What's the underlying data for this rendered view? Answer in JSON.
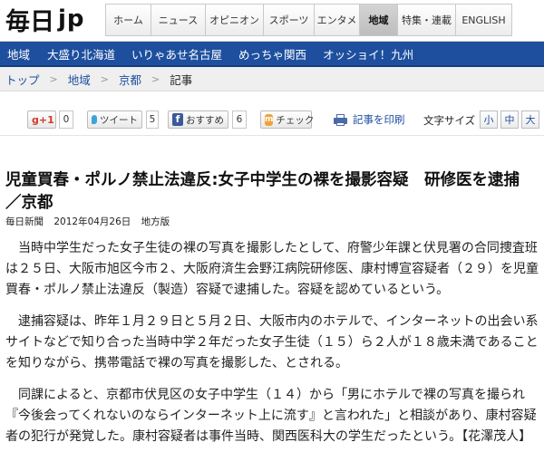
{
  "site": {
    "logo_main": "毎日",
    "logo_jp": "jp"
  },
  "global_nav": [
    {
      "label": "ホーム",
      "active": false
    },
    {
      "label": "ニュース",
      "active": false
    },
    {
      "label": "オピニオン",
      "active": false
    },
    {
      "label": "スポーツ",
      "active": false
    },
    {
      "label": "エンタメ",
      "active": false
    },
    {
      "label": "地域",
      "active": true
    },
    {
      "label": "特集・連載",
      "active": false
    },
    {
      "label": "ENGLISH",
      "active": false
    }
  ],
  "region_nav": [
    "地域",
    "大盛り北海道",
    "いりゃあせ名古屋",
    "めっちゃ関西",
    "オッショイ！九州"
  ],
  "breadcrumb": {
    "items": [
      "トップ",
      "地域",
      "京都"
    ],
    "current": "記事"
  },
  "toolbar": {
    "gplus_label": "+1",
    "gplus_count": "0",
    "tweet_label": "ツイート",
    "tweet_count": "5",
    "fb_label": "おすすめ",
    "fb_count": "6",
    "mixi_label": "チェック",
    "mixi_icon_text": "m",
    "print_label": "記事を印刷",
    "font_size_label": "文字サイズ",
    "font_small": "小",
    "font_medium": "中",
    "font_large": "大"
  },
  "article": {
    "headline": "児童買春・ポルノ禁止法違反:女子中学生の裸を撮影容疑　研修医を逮捕　／京都",
    "source": "毎日新聞",
    "date": "2012年04月26日",
    "section": "地方版",
    "paragraphs": [
      "当時中学生だった女子生徒の裸の写真を撮影したとして、府警少年課と伏見署の合同捜査班は２５日、大阪市旭区今市２、大阪府済生会野江病院研修医、康村博宣容疑者（２９）を児童買春・ポルノ禁止法違反（製造）容疑で逮捕した。容疑を認めているという。",
      "逮捕容疑は、昨年１月２９日と５月２日、大阪市内のホテルで、インターネットの出会い系サイトなどで知り合った当時中学２年だった女子生徒（１５）ら２人が１８歳未満であることを知りながら、携帯電話で裸の写真を撮影した、とされる。",
      "同課によると、京都市伏見区の女子中学生（１４）から「男にホテルで裸の写真を撮られ『今後会ってくれないのならインターネット上に流す』と言われた」と相談があり、康村容疑者の犯行が発覚した。康村容疑者は事件当時、関西医科大の学生だったという。【花澤茂人】"
    ]
  },
  "colors": {
    "accent": "#1d4f9e",
    "gplus": "#d23c2a",
    "facebook": "#3b5998",
    "twitter": "#3fa3d8",
    "mixi": "#f0a23a"
  }
}
